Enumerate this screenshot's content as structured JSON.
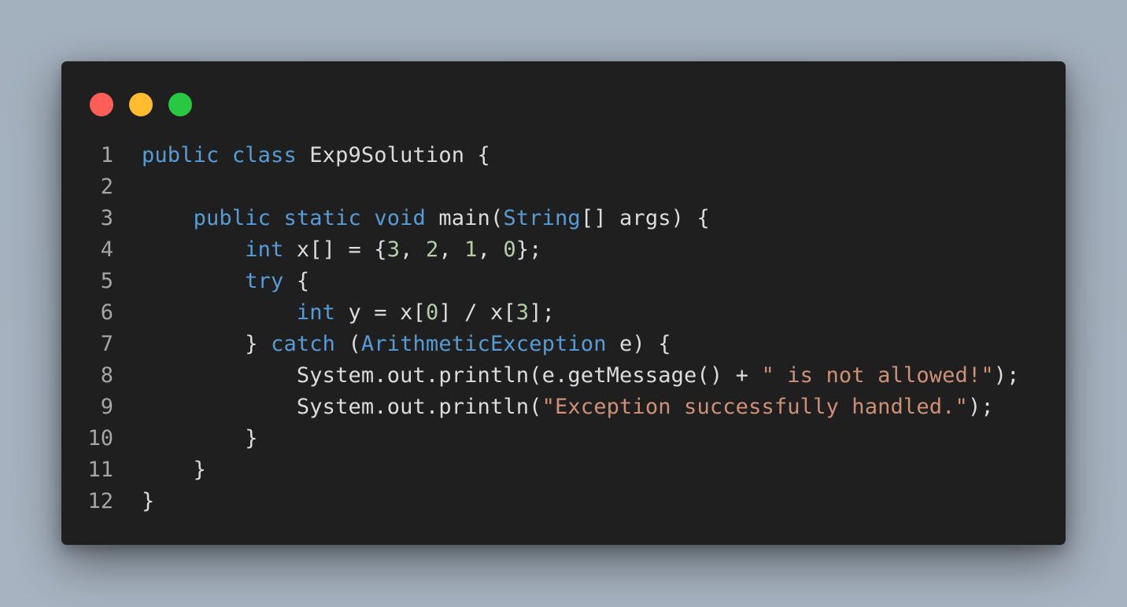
{
  "window": {
    "controls": [
      {
        "name": "close-dot",
        "color": "#ff5f57"
      },
      {
        "name": "minimize-dot",
        "color": "#febc2e"
      },
      {
        "name": "zoom-dot",
        "color": "#28c840"
      }
    ]
  },
  "colors": {
    "keyword": "#569cd6",
    "type": "#4ec9b0",
    "string": "#ce9178",
    "number": "#b5cea8",
    "text": "#dcdcdc",
    "line_number": "#a6a6a6"
  },
  "language": "Java",
  "code": {
    "lines": [
      {
        "number": "1",
        "tokens": [
          {
            "t": "kw",
            "v": "public"
          },
          {
            "t": "plain",
            "v": " "
          },
          {
            "t": "kw",
            "v": "class"
          },
          {
            "t": "plain",
            "v": " Exp9Solution {"
          }
        ]
      },
      {
        "number": "2",
        "tokens": []
      },
      {
        "number": "3",
        "tokens": [
          {
            "t": "plain",
            "v": "    "
          },
          {
            "t": "kw",
            "v": "public"
          },
          {
            "t": "plain",
            "v": " "
          },
          {
            "t": "kw",
            "v": "static"
          },
          {
            "t": "plain",
            "v": " "
          },
          {
            "t": "kw",
            "v": "void"
          },
          {
            "t": "plain",
            "v": " main("
          },
          {
            "t": "kw",
            "v": "String"
          },
          {
            "t": "plain",
            "v": "[] args) {"
          }
        ]
      },
      {
        "number": "4",
        "tokens": [
          {
            "t": "plain",
            "v": "        "
          },
          {
            "t": "kw",
            "v": "int"
          },
          {
            "t": "plain",
            "v": " x[] = {"
          },
          {
            "t": "num",
            "v": "3"
          },
          {
            "t": "plain",
            "v": ", "
          },
          {
            "t": "num",
            "v": "2"
          },
          {
            "t": "plain",
            "v": ", "
          },
          {
            "t": "num",
            "v": "1"
          },
          {
            "t": "plain",
            "v": ", "
          },
          {
            "t": "num",
            "v": "0"
          },
          {
            "t": "plain",
            "v": "};"
          }
        ]
      },
      {
        "number": "5",
        "tokens": [
          {
            "t": "plain",
            "v": "        "
          },
          {
            "t": "kw",
            "v": "try"
          },
          {
            "t": "plain",
            "v": " {"
          }
        ]
      },
      {
        "number": "6",
        "tokens": [
          {
            "t": "plain",
            "v": "            "
          },
          {
            "t": "kw",
            "v": "int"
          },
          {
            "t": "plain",
            "v": " y = x["
          },
          {
            "t": "num",
            "v": "0"
          },
          {
            "t": "plain",
            "v": "] / x["
          },
          {
            "t": "num",
            "v": "3"
          },
          {
            "t": "plain",
            "v": "];"
          }
        ]
      },
      {
        "number": "7",
        "tokens": [
          {
            "t": "plain",
            "v": "        } "
          },
          {
            "t": "kw",
            "v": "catch"
          },
          {
            "t": "plain",
            "v": " ("
          },
          {
            "t": "kw",
            "v": "ArithmeticException"
          },
          {
            "t": "plain",
            "v": " e) {"
          }
        ]
      },
      {
        "number": "8",
        "tokens": [
          {
            "t": "plain",
            "v": "            System.out.println(e.getMessage() + "
          },
          {
            "t": "str",
            "v": "\" is not allowed!\""
          },
          {
            "t": "plain",
            "v": ");"
          }
        ]
      },
      {
        "number": "9",
        "tokens": [
          {
            "t": "plain",
            "v": "            System.out.println("
          },
          {
            "t": "str",
            "v": "\"Exception successfully handled.\""
          },
          {
            "t": "plain",
            "v": ");"
          }
        ]
      },
      {
        "number": "10",
        "tokens": [
          {
            "t": "plain",
            "v": "        }"
          }
        ]
      },
      {
        "number": "11",
        "tokens": [
          {
            "t": "plain",
            "v": "    }"
          }
        ]
      },
      {
        "number": "12",
        "tokens": [
          {
            "t": "plain",
            "v": "}"
          }
        ]
      }
    ]
  }
}
